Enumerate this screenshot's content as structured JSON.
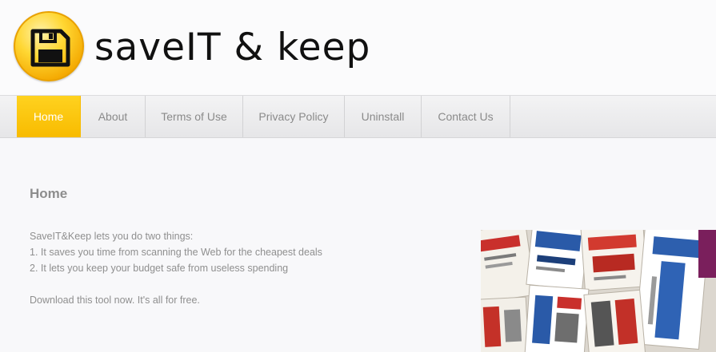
{
  "brand": {
    "logo_icon": "floppy-disk-icon",
    "name": "saveIT & keep"
  },
  "nav": {
    "items": [
      {
        "label": "Home",
        "active": true
      },
      {
        "label": "About"
      },
      {
        "label": "Terms of Use"
      },
      {
        "label": "Privacy Policy"
      },
      {
        "label": "Uninstall"
      },
      {
        "label": "Contact Us"
      }
    ]
  },
  "main": {
    "title": "Home",
    "intro": "SaveIT&Keep lets you do two things:",
    "point1": "1. It saves you time from scanning the Web for the cheapest deals",
    "point2": "2. It lets you keep your budget safe from useless spending",
    "cta": "Download this tool now. It's all for free."
  },
  "colors": {
    "accent": "#f9c300",
    "nav_text": "#8a8a8a",
    "body_text": "#8f8f8f"
  }
}
